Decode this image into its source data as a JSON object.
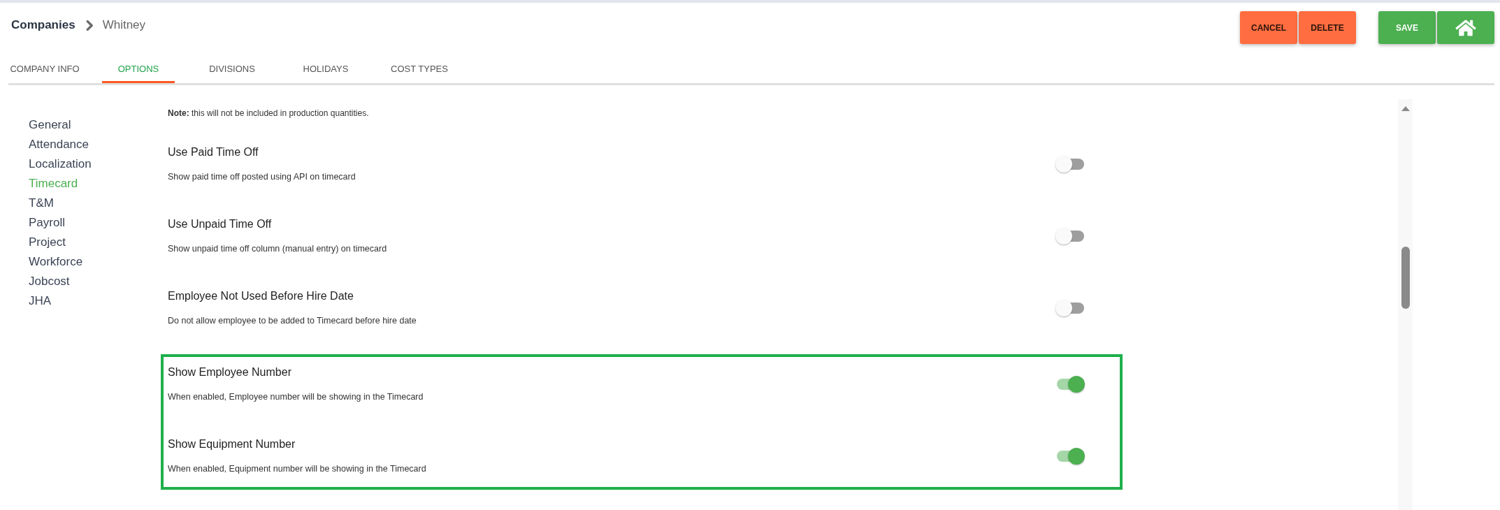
{
  "breadcrumb": {
    "parent": "Companies",
    "current": "Whitney"
  },
  "action_groups": [
    {
      "buttons": [
        {
          "kind": "danger",
          "label": "CANCEL"
        },
        {
          "kind": "danger",
          "label": "DELETE"
        }
      ]
    },
    {
      "buttons": [
        {
          "kind": "primary",
          "label": "SAVE"
        },
        {
          "kind": "home"
        }
      ]
    }
  ],
  "tabs": [
    {
      "label": "COMPANY INFO",
      "selected": false
    },
    {
      "label": "OPTIONS",
      "selected": true
    },
    {
      "label": "DIVISIONS",
      "selected": false
    },
    {
      "label": "HOLIDAYS",
      "selected": false
    },
    {
      "label": "COST TYPES",
      "selected": false
    }
  ],
  "sidebar": {
    "items": [
      {
        "label": "General",
        "selected": false
      },
      {
        "label": "Attendance",
        "selected": false
      },
      {
        "label": "Localization",
        "selected": false
      },
      {
        "label": "Timecard",
        "selected": true
      },
      {
        "label": "T&M",
        "selected": false
      },
      {
        "label": "Payroll",
        "selected": false
      },
      {
        "label": "Project",
        "selected": false
      },
      {
        "label": "Workforce",
        "selected": false
      },
      {
        "label": "Jobcost",
        "selected": false
      },
      {
        "label": "JHA",
        "selected": false
      }
    ]
  },
  "settings": {
    "note": "**Note:** this will not be included in production quantities.",
    "groups": [
      {
        "items": [
          {
            "title": "Use Paid Time Off",
            "description": "Show paid time off posted using API on timecard",
            "on": false
          },
          {
            "title": "Use Unpaid Time Off",
            "description": "Show unpaid time off column (manual entry) on timecard",
            "on": false
          },
          {
            "title": "Employee Not Used Before Hire Date",
            "description": "Do not allow employee to be added to Timecard before hire date",
            "on": false
          }
        ]
      },
      {
        "highlighted": true,
        "items": [
          {
            "title": "Show Employee Number",
            "description": "When enabled, Employee number will be showing in the Timecard",
            "on": true
          },
          {
            "title": "Show Equipment Number",
            "description": "When enabled, Equipment number will be showing in the Timecard",
            "on": true
          }
        ]
      }
    ]
  }
}
